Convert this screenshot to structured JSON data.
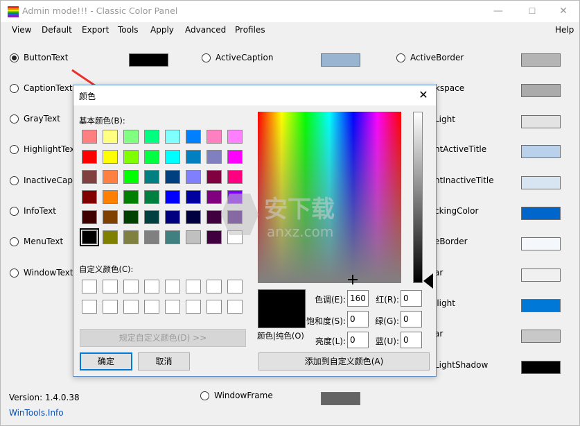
{
  "window": {
    "title": "Admin mode!!! - Classic Color Panel",
    "minimize": "—",
    "maximize": "☐",
    "close": "✕"
  },
  "menu": [
    "View",
    "Default",
    "Export",
    "Tools",
    "Apply",
    "Advanced",
    "Profiles"
  ],
  "menu_help": "Help",
  "color_items_col1": [
    {
      "label": "ButtonText",
      "checked": true,
      "swatch": "#000000"
    },
    {
      "label": "CaptionText",
      "checked": false
    },
    {
      "label": "GrayText",
      "checked": false
    },
    {
      "label": "HighlightText",
      "checked": false
    },
    {
      "label": "InactiveCaptio",
      "checked": false
    },
    {
      "label": "InfoText",
      "checked": false
    },
    {
      "label": "MenuText",
      "checked": false
    },
    {
      "label": "WindowText",
      "checked": false
    }
  ],
  "color_items_col2": [
    {
      "label": "ActiveCaption",
      "swatch": "#99b4d1"
    },
    {
      "label": "WindowFrame",
      "swatch": "#646464"
    }
  ],
  "color_items_col3": [
    {
      "label": "ActiveBorder",
      "swatch": "#b4b4b4"
    },
    {
      "label": "rkspace",
      "swatch": "#ababab"
    },
    {
      "label": "Light",
      "swatch": "#e3e3e3"
    },
    {
      "label": "ntActiveTitle",
      "swatch": "#b9d1ea"
    },
    {
      "label": "ntInactiveTitle",
      "swatch": "#d7e4f2"
    },
    {
      "label": "ckingColor",
      "swatch": "#0066cc"
    },
    {
      "label": "eBorder",
      "swatch": "#f4f7fc"
    },
    {
      "label": "ar",
      "swatch": "#f0f0f0"
    },
    {
      "label": "ilight",
      "swatch": "#0078d7"
    },
    {
      "label": "ar",
      "swatch": "#c8c8c8"
    },
    {
      "label": "LightShadow",
      "swatch": "#000000"
    }
  ],
  "footer": {
    "version": "Version: 1.4.0.38",
    "link": "WinTools.Info"
  },
  "dialog": {
    "title": "颜色",
    "close": "✕",
    "basic_label": "基本颜色(B):",
    "custom_label": "自定义颜色(C):",
    "define_custom": "规定自定义颜色(D) >>",
    "ok": "确定",
    "cancel": "取消",
    "add_custom": "添加到自定义颜色(A)",
    "preview_label": "颜色|纯色(O)",
    "hue_label": "色调(E):",
    "hue": "160",
    "sat_label": "饱和度(S):",
    "sat": "0",
    "lum_label": "亮度(L):",
    "lum": "0",
    "red_label": "红(R):",
    "red": "0",
    "green_label": "绿(G):",
    "green": "0",
    "blue_label": "蓝(U):",
    "blue": "0",
    "basic_colors": [
      "#ff8080",
      "#ffff80",
      "#80ff80",
      "#00ff80",
      "#80ffff",
      "#0080ff",
      "#ff80c0",
      "#ff80ff",
      "#ff0000",
      "#ffff00",
      "#80ff00",
      "#00ff40",
      "#00ffff",
      "#0080c0",
      "#8080c0",
      "#ff00ff",
      "#804040",
      "#ff8040",
      "#00ff00",
      "#008080",
      "#004080",
      "#8080ff",
      "#800040",
      "#ff0080",
      "#800000",
      "#ff8000",
      "#008000",
      "#008040",
      "#0000ff",
      "#0000a0",
      "#800080",
      "#8000ff",
      "#400000",
      "#804000",
      "#004000",
      "#004040",
      "#000080",
      "#000040",
      "#400040",
      "#400080",
      "#000000",
      "#808000",
      "#808040",
      "#808080",
      "#408080",
      "#c0c0c0",
      "#400040",
      "#ffffff"
    ],
    "selected_index": 40
  },
  "watermark": {
    "text": "安下载",
    "sub": "anxz.com"
  }
}
